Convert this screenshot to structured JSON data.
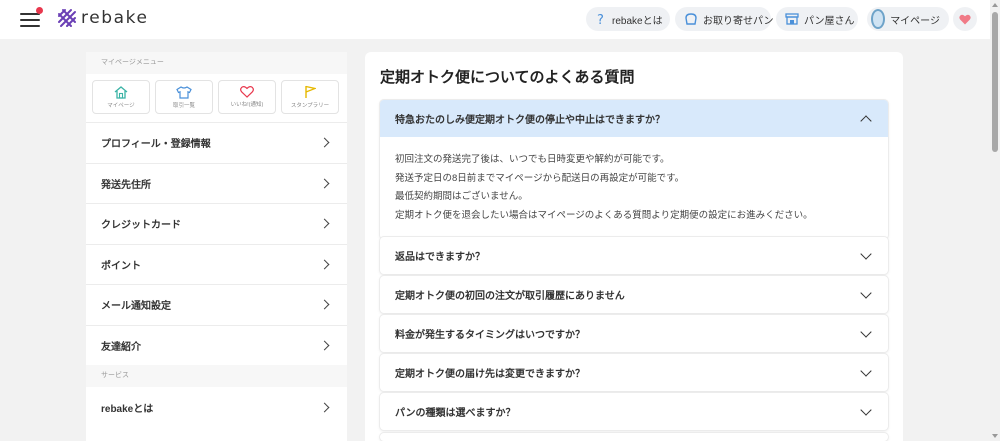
{
  "header": {
    "logo_text": "rebake",
    "nav": [
      {
        "label": "rebakeとは",
        "icon": "question-icon"
      },
      {
        "label": "お取り寄せパン",
        "icon": "bread-icon"
      },
      {
        "label": "パン屋さん",
        "icon": "shop-icon"
      },
      {
        "label": "マイページ",
        "icon": "avatar"
      }
    ],
    "favorite_icon": "heart-icon",
    "notification_color": "#e8374d"
  },
  "sidebar": {
    "section_mypage": "マイページメニュー",
    "quick_links": [
      {
        "label": "マイページ",
        "icon": "home-icon"
      },
      {
        "label": "取引一覧",
        "icon": "shirt-icon"
      },
      {
        "label": "いいね!(通知)",
        "icon": "heart-outline-icon"
      },
      {
        "label": "スタンプラリー",
        "icon": "flag-icon"
      }
    ],
    "items": [
      {
        "label": "プロフィール・登録情報"
      },
      {
        "label": "発送先住所"
      },
      {
        "label": "クレジットカード"
      },
      {
        "label": "ポイント"
      },
      {
        "label": "メール通知設定"
      },
      {
        "label": "友達紹介"
      }
    ],
    "section_service": "サービス",
    "service_items": [
      {
        "label": "rebakeとは"
      }
    ]
  },
  "main": {
    "title": "定期オトク便についてのよくある質問",
    "faqs": [
      {
        "question": "特急おたのしみ便定期オトク便の停止や中止はできますか？",
        "open": true,
        "answer_lines": [
          "初回注文の発送完了後は、いつでも日時変更や解約が可能です。",
          "発送予定日の8日前までマイページから配送日の再設定が可能です。",
          "最低契約期間はございません。",
          "定期オトク便を退会したい場合はマイページのよくある質問より定期便の設定にお進みください。"
        ]
      },
      {
        "question": "返品はできますか？",
        "open": false
      },
      {
        "question": "定期オトク便の初回の注文が取引履歴にありません",
        "open": false
      },
      {
        "question": "料金が発生するタイミングはいつですか？",
        "open": false
      },
      {
        "question": "定期オトク便の届け先は変更できますか？",
        "open": false
      },
      {
        "question": "パンの種類は選べますか？",
        "open": false
      }
    ]
  },
  "colors": {
    "accent_open": "#d8e9fb",
    "heart": "#f07a87",
    "logo_purple": "#6a3fb5"
  }
}
